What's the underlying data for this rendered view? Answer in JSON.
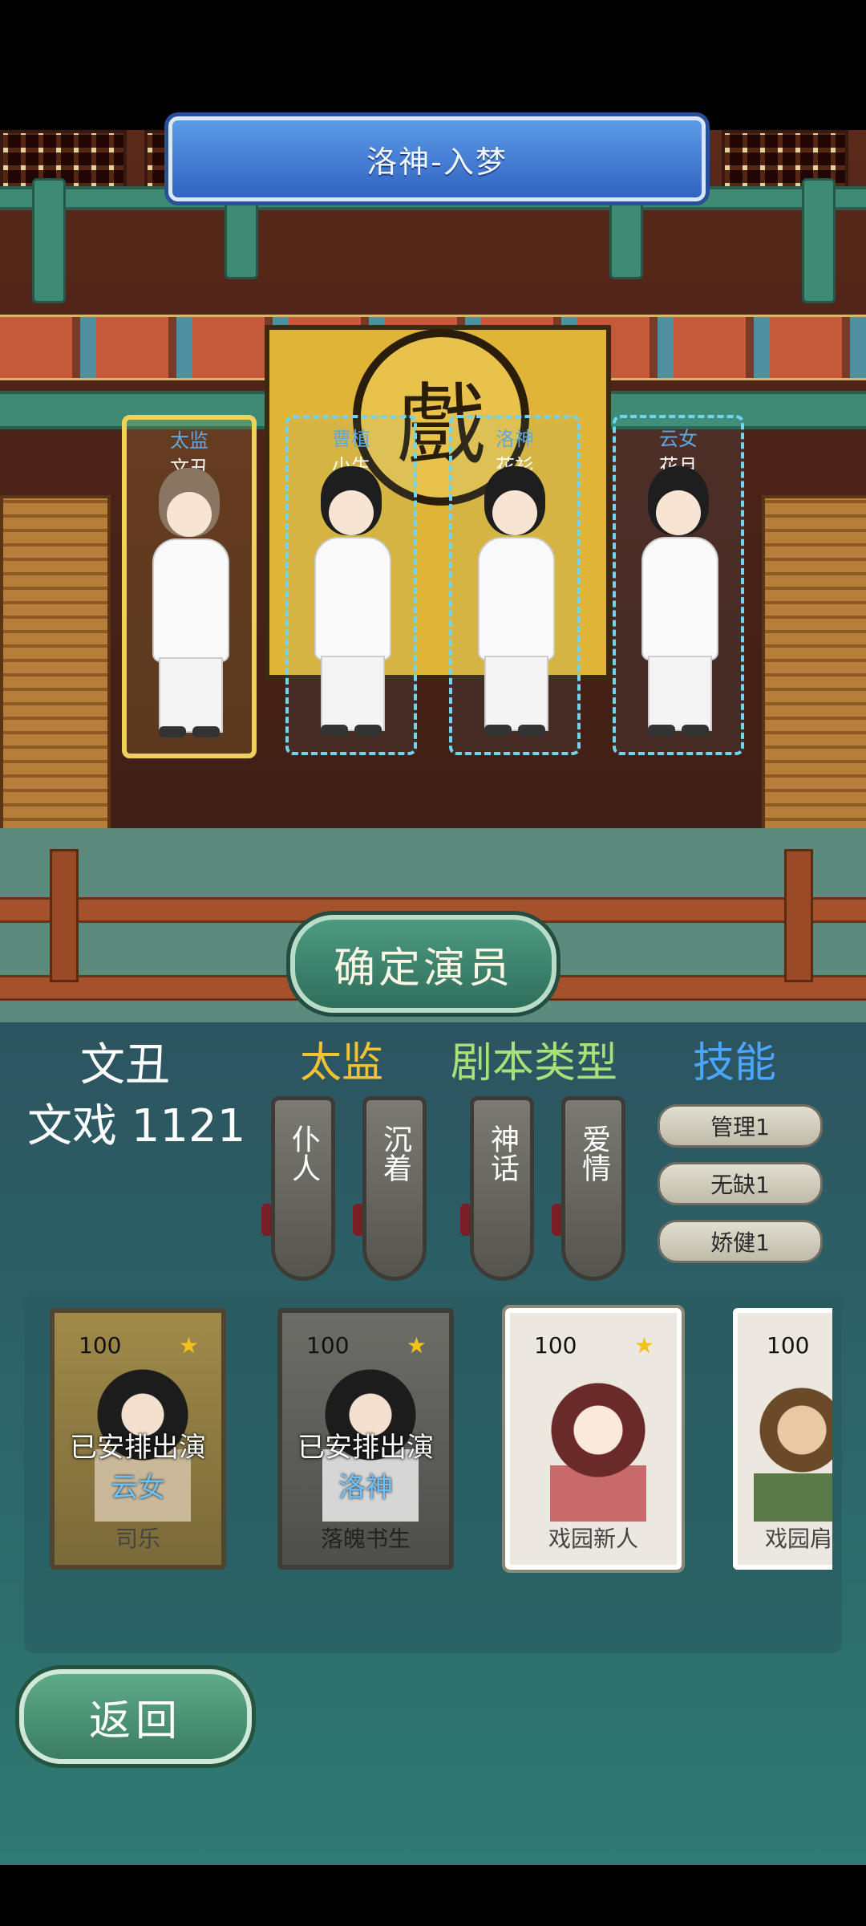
{
  "stage": {
    "title": "洛神-入梦",
    "emblem_char": "戲",
    "confirm_label": "确定演员"
  },
  "slots": [
    {
      "role_top": "太监",
      "role_bottom": "文丑",
      "selected": true
    },
    {
      "role_top": "曹植",
      "role_bottom": "小生",
      "selected": false
    },
    {
      "role_top": "洛神",
      "role_bottom": "花衫",
      "selected": false
    },
    {
      "role_top": "云女",
      "role_bottom": "花旦",
      "selected": false
    }
  ],
  "info": {
    "actor_type": "文丑",
    "score_label": "文戏 1121",
    "role_header": "太监",
    "script_header": "剧本类型",
    "skill_header": "技能"
  },
  "role_tags": [
    "仆人",
    "沉着"
  ],
  "script_tags": [
    "神话",
    "爱情"
  ],
  "skills": [
    "管理1",
    "无缺1",
    "娇健1"
  ],
  "cards": [
    {
      "value": "100",
      "name": "司乐",
      "status": "已安排出演",
      "assigned": "云女",
      "style": "gold"
    },
    {
      "value": "100",
      "name": "落魄书生",
      "status": "已安排出演",
      "assigned": "洛神",
      "style": "gray"
    },
    {
      "value": "100",
      "name": "戏园新人",
      "status": "",
      "assigned": "",
      "style": "white"
    },
    {
      "value": "100",
      "name": "戏园肩",
      "status": "",
      "assigned": "",
      "style": "white"
    }
  ],
  "back_label": "返回",
  "colors": {
    "role_header": "#f2c230",
    "script_header": "#a8e07a",
    "skill_header": "#4aa6ff",
    "selected_border": "#f0d25a",
    "dash_border": "#6fd5f0"
  }
}
